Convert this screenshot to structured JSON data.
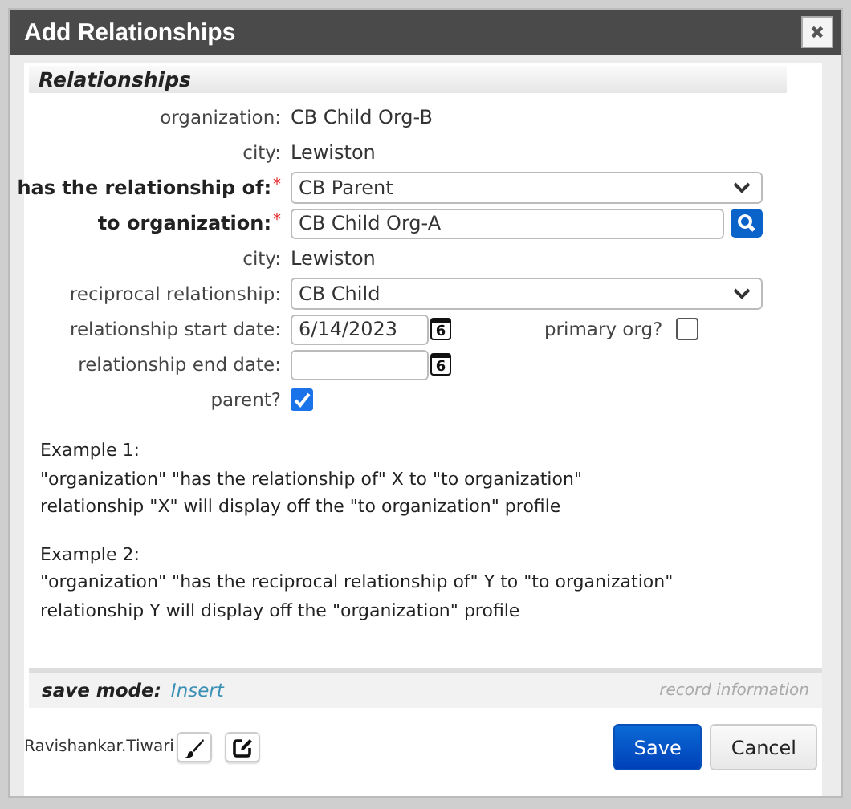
{
  "window": {
    "title": "Add Relationships",
    "close": "✖"
  },
  "section": {
    "title": "Relationships"
  },
  "fields": [
    {
      "kind": "text",
      "label": "organization:",
      "value": "CB Child Org-B"
    },
    {
      "kind": "text",
      "label": "city:",
      "value": "Lewiston"
    },
    {
      "kind": "select",
      "label": "has the relationship of:",
      "required_mark": "*",
      "value": "CB Parent"
    },
    {
      "kind": "lookup",
      "label": "to organization:",
      "required_mark": "*",
      "value": "CB Child Org-A"
    },
    {
      "kind": "text",
      "label": "city:",
      "value": "Lewiston"
    },
    {
      "kind": "select",
      "label": "reciprocal relationship:",
      "value": "CB Child"
    },
    {
      "kind": "date",
      "label": "relationship start date:",
      "value": "6/14/2023",
      "calendar_day": "6",
      "extra": {
        "label": "primary org?",
        "checked": false
      }
    },
    {
      "kind": "date",
      "label": "relationship end date:",
      "calendar_day": "6"
    },
    {
      "kind": "checkbox",
      "label": "parent?",
      "checked": true
    }
  ],
  "examples": [
    {
      "lines": [
        "Example 1:",
        "\"organization\" \"has the relationship of\" X to \"to organization\"",
        "relationship \"X\" will display off the \"to organization\" profile"
      ]
    },
    {
      "lines": [
        "Example 2:",
        "\"organization\" \"has the reciprocal relationship of\" Y to \"to organization\"",
        "relationship Y will display off the \"organization\" profile"
      ]
    }
  ],
  "footer": {
    "save_mode_label": "save mode:",
    "save_mode": "Insert",
    "record_info": "record information",
    "user": "Ravishankar.Tiwari",
    "buttons": [
      {
        "label": "Save",
        "kind": "primary"
      },
      {
        "label": "Cancel",
        "kind": "secondary"
      }
    ]
  }
}
